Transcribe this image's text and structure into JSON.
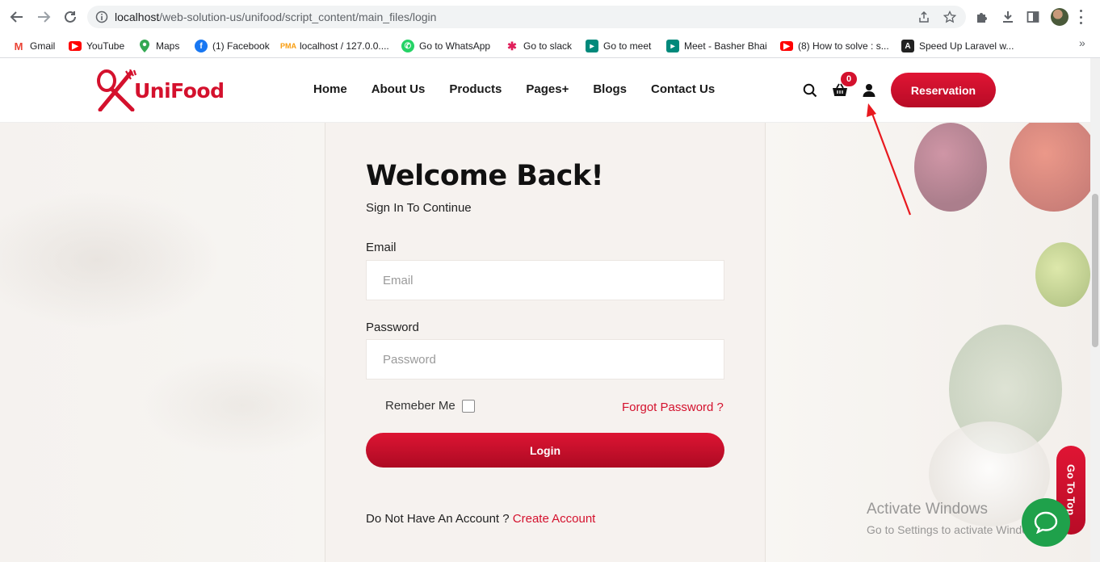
{
  "browser": {
    "url_host": "localhost",
    "url_path": "/web-solution-us/unifood/script_content/main_files/login",
    "icons": [
      "back-arrow-icon",
      "forward-arrow-icon",
      "reload-icon",
      "info-icon",
      "share-icon",
      "star-icon",
      "puzzle-icon",
      "download-icon",
      "sidepanel-icon",
      "profile-avatar",
      "kebab-menu-icon"
    ]
  },
  "bookmarks": [
    {
      "label": "Gmail",
      "icon": "gmail-icon",
      "color": "#ea4335"
    },
    {
      "label": "YouTube",
      "icon": "youtube-icon",
      "color": "#ff0000"
    },
    {
      "label": "Maps",
      "icon": "maps-icon",
      "color": "#34a853"
    },
    {
      "label": "(1) Facebook",
      "icon": "facebook-icon",
      "color": "#1877f2"
    },
    {
      "label": "localhost / 127.0.0....",
      "icon": "phpmyadmin-icon",
      "color": "#f89c0e"
    },
    {
      "label": "Go to WhatsApp",
      "icon": "whatsapp-icon",
      "color": "#25d366"
    },
    {
      "label": "Go to slack",
      "icon": "slack-icon",
      "color": "#e01e5a"
    },
    {
      "label": "Go to meet",
      "icon": "meet-icon",
      "color": "#00897b"
    },
    {
      "label": "Meet - Basher Bhai",
      "icon": "meet-icon",
      "color": "#00897b"
    },
    {
      "label": "(8) How to solve : s...",
      "icon": "youtube-icon",
      "color": "#ff0000"
    },
    {
      "label": "Speed Up Laravel w...",
      "icon": "laravel-icon",
      "color": "#222222"
    }
  ],
  "header": {
    "logo_text": "UniFood",
    "nav": [
      "Home",
      "About Us",
      "Products",
      "Pages",
      "Blogs",
      "Contact Us"
    ],
    "pages_suffix": "+",
    "cart_count": "0",
    "reservation_label": "Reservation",
    "brand_color": "#d4112d"
  },
  "login": {
    "title": "Welcome Back!",
    "subtitle": "Sign In To Continue",
    "email_label": "Email",
    "email_placeholder": "Email",
    "password_label": "Password",
    "password_placeholder": "Password",
    "remember_label": "Remeber Me",
    "forgot_label": "Forgot Password ?",
    "login_label": "Login",
    "no_account_text": "Do Not Have An Account ?",
    "create_account_label": "Create Account"
  },
  "overlay": {
    "go_to_top": "Go To Top",
    "activate_title": "Activate Windows",
    "activate_sub": "Go to Settings to activate Windows."
  }
}
